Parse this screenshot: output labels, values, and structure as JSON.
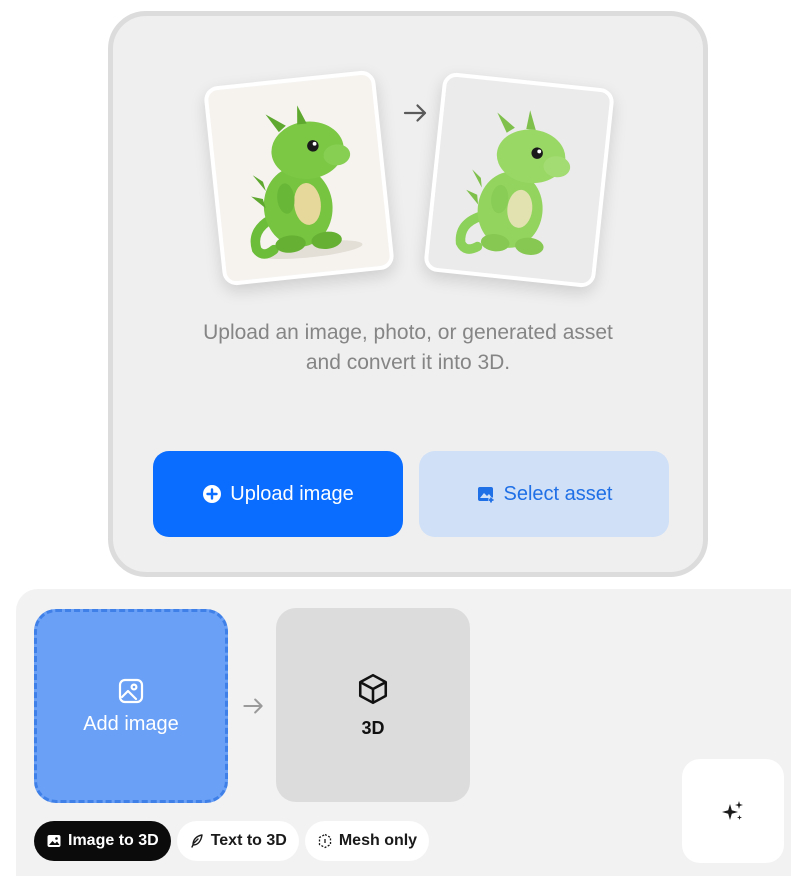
{
  "upload": {
    "description_line1": "Upload an image, photo, or generated asset",
    "description_line2": "and convert it into 3D.",
    "upload_button_label": "Upload image",
    "select_button_label": "Select asset"
  },
  "workflow": {
    "add_image_label": "Add image",
    "output_label": "3D"
  },
  "modes": [
    {
      "label": "Image to 3D",
      "active": true,
      "icon": "image-icon"
    },
    {
      "label": "Text to 3D",
      "active": false,
      "icon": "feather-icon"
    },
    {
      "label": "Mesh only",
      "active": false,
      "icon": "mesh-icon"
    }
  ],
  "icons": {
    "upload": "plus-circle-icon",
    "select": "asset-icon",
    "add_image": "image-add-icon",
    "output": "cube-icon",
    "generate": "sparkle-icon"
  },
  "colors": {
    "primary": "#0a6dff",
    "secondary_bg": "#cfe0f7",
    "dropzone": "#6aa0f5",
    "active_tab": "#0b0b0b"
  }
}
